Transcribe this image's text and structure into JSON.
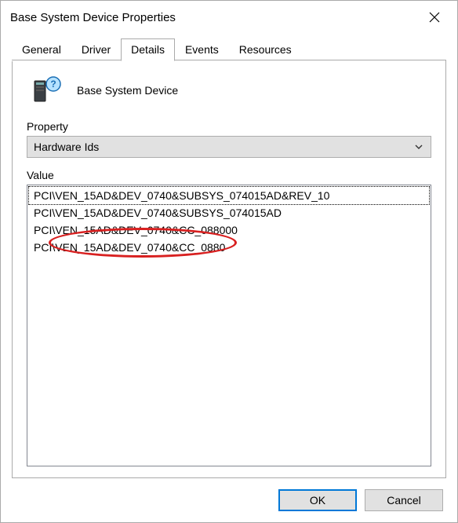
{
  "window": {
    "title": "Base System Device Properties"
  },
  "tabs": [
    {
      "label": "General"
    },
    {
      "label": "Driver"
    },
    {
      "label": "Details"
    },
    {
      "label": "Events"
    },
    {
      "label": "Resources"
    }
  ],
  "device": {
    "name": "Base System Device",
    "icon": "pc-help-icon"
  },
  "property": {
    "label": "Property",
    "selected": "Hardware Ids"
  },
  "value": {
    "label": "Value",
    "items": [
      "PCI\\VEN_15AD&DEV_0740&SUBSYS_074015AD&REV_10",
      "PCI\\VEN_15AD&DEV_0740&SUBSYS_074015AD",
      "PCI\\VEN_15AD&DEV_0740&CC_088000",
      "PCI\\VEN_15AD&DEV_0740&CC_0880"
    ],
    "selected_index": 0
  },
  "buttons": {
    "ok": "OK",
    "cancel": "Cancel"
  },
  "annotation": {
    "kind": "ellipse",
    "note": "red oval highlighting VEN_15AD&DEV_0740 segment of first hardware id"
  }
}
